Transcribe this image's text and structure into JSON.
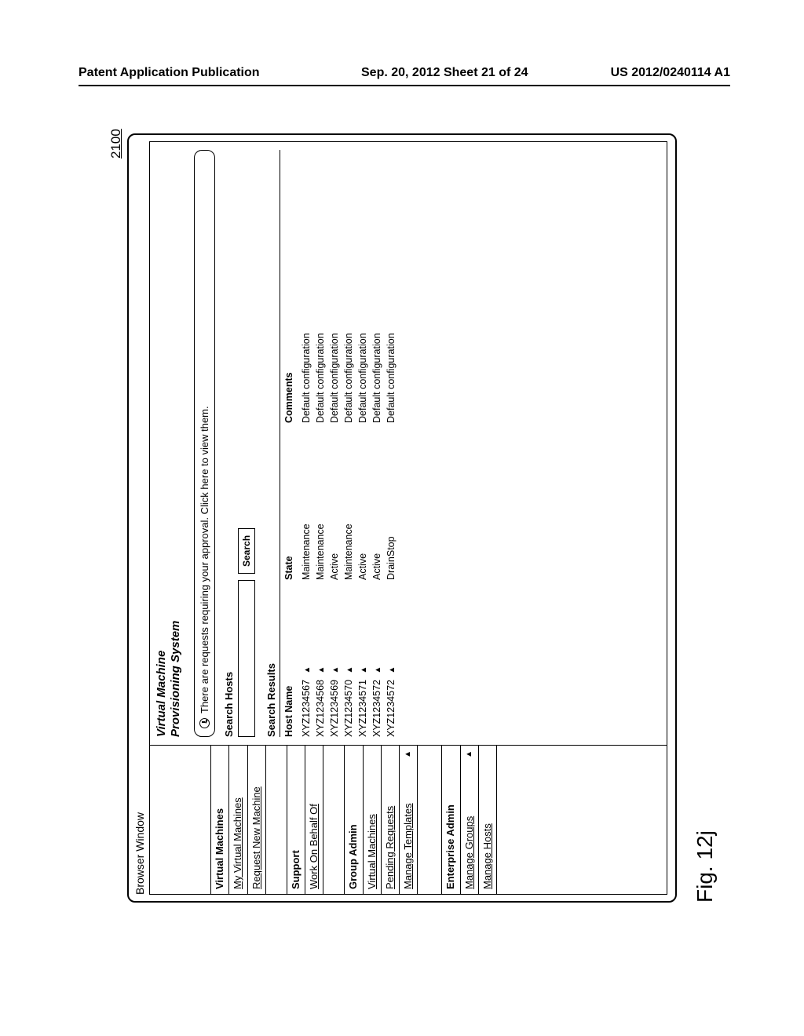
{
  "doc_header": {
    "left": "Patent Application Publication",
    "center": "Sep. 20, 2012  Sheet 21 of 24",
    "right": "US 2012/0240114 A1"
  },
  "figure_reference": "2100",
  "figure_label": "Fig. 12j",
  "browser_title": "Browser Window",
  "brand_line1": "Virtual Machine",
  "brand_line2": "Provisioning System",
  "notice_text": "There are requests requiring your approval.  Click here to view them.",
  "sidebar": {
    "sections": [
      {
        "title": "Virtual Machines",
        "items": [
          {
            "label": "My Virtual Machines",
            "link": true
          },
          {
            "label": "Request New Machine",
            "link": true
          }
        ]
      },
      {
        "title": "Support",
        "items": [
          {
            "label": "Work On Behalf Of",
            "link": true
          }
        ]
      },
      {
        "title": "Group Admin",
        "items": [
          {
            "label": "Virtual Machines",
            "link": true
          },
          {
            "label": "Pending Requests",
            "link": true
          },
          {
            "label": "Manage Templates",
            "link": true,
            "caret": true
          }
        ]
      },
      {
        "title": "Enterprise Admin",
        "items": [
          {
            "label": "Manage Groups",
            "link": true,
            "caret": true
          },
          {
            "label": "Manage Hosts",
            "link": true
          }
        ]
      }
    ]
  },
  "search": {
    "heading": "Search Hosts",
    "value": "",
    "button": "Search"
  },
  "results": {
    "heading": "Search Results",
    "columns": {
      "host": "Host Name",
      "state": "State",
      "comments": "Comments"
    },
    "rows": [
      {
        "host": "XYZ1234567",
        "state": "Maintenance",
        "comments": "Default configuration"
      },
      {
        "host": "XYZ1234568",
        "state": "Maintenance",
        "comments": "Default configuration"
      },
      {
        "host": "XYZ1234569",
        "state": "Active",
        "comments": "Default configuration"
      },
      {
        "host": "XYZ1234570",
        "state": "Maintenance",
        "comments": "Default configuration"
      },
      {
        "host": "XYZ1234571",
        "state": "Active",
        "comments": "Default configuration"
      },
      {
        "host": "XYZ1234572",
        "state": "Active",
        "comments": "Default configuration"
      },
      {
        "host": "XYZ1234572",
        "state": "DrainStop",
        "comments": "Default configuration"
      }
    ]
  }
}
